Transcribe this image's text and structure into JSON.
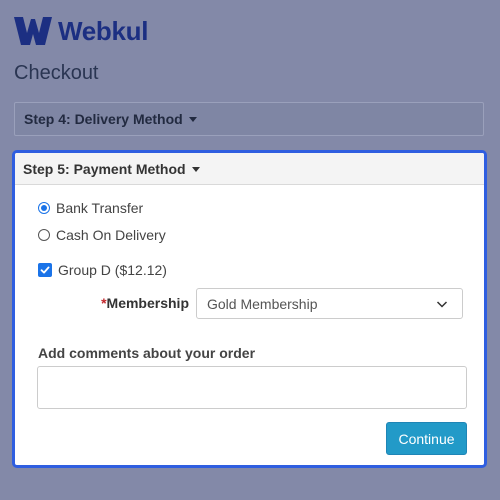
{
  "brand": {
    "name": "Webkul",
    "color": "#1c2f82"
  },
  "page": {
    "title": "Checkout"
  },
  "steps": {
    "delivery": {
      "label": "Step 4: Delivery Method",
      "icon": "caret-down-icon"
    },
    "payment": {
      "label": "Step 5: Payment Method",
      "icon": "caret-down-icon",
      "options": [
        {
          "label": "Bank Transfer",
          "selected": true
        },
        {
          "label": "Cash On Delivery",
          "selected": false
        }
      ],
      "group": {
        "label": "Group D ($12.12)",
        "checked": true
      },
      "membership": {
        "required_mark": "*",
        "label": "Membership",
        "value": "Gold Membership",
        "icon": "chevron-down-icon"
      },
      "comments": {
        "label": "Add comments about your order",
        "value": ""
      },
      "continue_label": "Continue"
    }
  },
  "colors": {
    "accent": "#2f5ee0",
    "button": "#229ac8",
    "required": "#c2262b",
    "check": "#1a73e8"
  }
}
